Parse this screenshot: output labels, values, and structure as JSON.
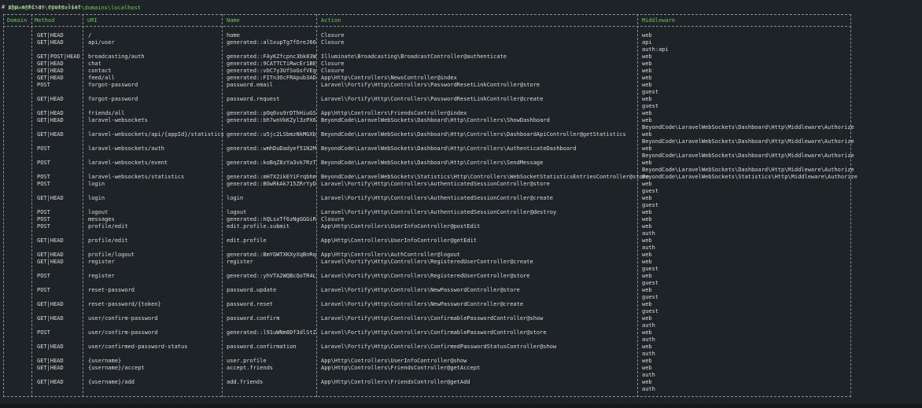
{
  "terminal": {
    "prompt": "Админ@PC d:\\OpenServer\\domains\\localhost",
    "command": "# php artisan route:list"
  },
  "columns": [
    "Domain",
    "Method",
    "URI",
    "Name",
    "Action",
    "Middleware"
  ],
  "lines": {
    "method": [
      "GET|HEAD",
      "GET|HEAD",
      "",
      "GET|POST|HEAD",
      "GET|HEAD",
      "GET|HEAD",
      "GET|HEAD",
      "POST",
      "",
      "GET|HEAD",
      "",
      "GET|HEAD",
      "GET|HEAD",
      "",
      "GET|HEAD",
      "",
      "POST",
      "",
      "POST",
      "",
      "POST",
      "POST",
      "",
      "GET|HEAD",
      "",
      "POST",
      "POST",
      "POST",
      "",
      "GET|HEAD",
      "",
      "GET|HEAD",
      "GET|HEAD",
      "",
      "POST",
      "",
      "POST",
      "",
      "GET|HEAD",
      "",
      "GET|HEAD",
      "",
      "POST",
      "",
      "GET|HEAD",
      "",
      "GET|HEAD",
      "GET|HEAD",
      "",
      "GET|HEAD",
      ""
    ],
    "uri": [
      "/",
      "api/user",
      "",
      "broadcasting/auth",
      "chat",
      "contact",
      "feed/all",
      "forgot-password",
      "",
      "forgot-password",
      "",
      "friends/all",
      "laravel-websockets",
      "",
      "laravel-websockets/api/{appId}/statistics",
      "",
      "laravel-websockets/auth",
      "",
      "laravel-websockets/event",
      "",
      "laravel-websockets/statistics",
      "login",
      "",
      "login",
      "",
      "logout",
      "messages",
      "profile/edit",
      "",
      "profile/edit",
      "",
      "profile/logout",
      "register",
      "",
      "register",
      "",
      "reset-password",
      "",
      "reset-password/{token}",
      "",
      "user/confirm-password",
      "",
      "user/confirm-password",
      "",
      "user/confirmed-password-status",
      "",
      "{username}",
      "{username}/accept",
      "",
      "{username}/add",
      ""
    ],
    "name": [
      "home",
      "generated::alSxupTg7fOreJ66",
      "",
      "generated::FAyKZfcpnc3bk83W",
      "generated::9CATTCTiRwcEr1BE",
      "generated::vbC7y3UfSoGsfVEg",
      "generated::FITn3OcFRApub3AD",
      "password.email",
      "",
      "password.request",
      "",
      "generated::pOq6vu9rDThHiuGS",
      "generated::bh7wnVkKZyl3zPX6",
      "",
      "generated::u5jc2LSbmzNkMGXb",
      "",
      "generated::wmhDuDadyef51N2M",
      "",
      "generated::koBqZ8zYa3vk7RzT",
      "",
      "generated::mH7X2ikEYiFrqbhm",
      "generated::BOwRkAk715ZRrYyD",
      "",
      "login",
      "",
      "logout",
      "generated::hQLsxTf6zNgGGGiR",
      "edit.profile.submit",
      "",
      "edit.profile",
      "",
      "generated::BmYGWTXKXyXqBnRq",
      "register",
      "",
      "generated::yhVTA2WQBcQoTR4L",
      "",
      "password.update",
      "",
      "password.reset",
      "",
      "password.confirm",
      "",
      "generated::l91uWNm8Df3dlStZ",
      "",
      "password.confirmation",
      "",
      "user.profile",
      "accept.friends",
      "",
      "add.friends",
      ""
    ],
    "action": [
      "Closure",
      "Closure",
      "",
      "Illuminate\\Broadcasting\\BroadcastController@authenticate",
      "Closure",
      "Closure",
      "App\\Http\\Controllers\\NewsController@index",
      "Laravel\\Fortify\\Http\\Controllers\\PasswordResetLinkController@store",
      "",
      "Laravel\\Fortify\\Http\\Controllers\\PasswordResetLinkController@create",
      "",
      "App\\Http\\Controllers\\FriendsController@index",
      "BeyondCode\\LaravelWebSockets\\Dashboard\\Http\\Controllers\\ShowDashboard",
      "",
      "BeyondCode\\LaravelWebSockets\\Dashboard\\Http\\Controllers\\DashboardApiController@getStatistics",
      "",
      "BeyondCode\\LaravelWebSockets\\Dashboard\\Http\\Controllers\\AuthenticateDashboard",
      "",
      "BeyondCode\\LaravelWebSockets\\Dashboard\\Http\\Controllers\\SendMessage",
      "",
      "BeyondCode\\LaravelWebSockets\\Statistics\\Http\\Controllers\\WebSocketStatisticsEntriesController@store",
      "Laravel\\Fortify\\Http\\Controllers\\AuthenticatedSessionController@store",
      "",
      "Laravel\\Fortify\\Http\\Controllers\\AuthenticatedSessionController@create",
      "",
      "Laravel\\Fortify\\Http\\Controllers\\AuthenticatedSessionController@destroy",
      "Closure",
      "App\\Http\\Controllers\\UserInfoController@postEdit",
      "",
      "App\\Http\\Controllers\\UserInfoController@getEdit",
      "",
      "App\\Http\\Controllers\\AuthController@logout",
      "Laravel\\Fortify\\Http\\Controllers\\RegisteredUserController@create",
      "",
      "Laravel\\Fortify\\Http\\Controllers\\RegisteredUserController@store",
      "",
      "Laravel\\Fortify\\Http\\Controllers\\NewPasswordController@store",
      "",
      "Laravel\\Fortify\\Http\\Controllers\\NewPasswordController@create",
      "",
      "Laravel\\Fortify\\Http\\Controllers\\ConfirmablePasswordController@show",
      "",
      "Laravel\\Fortify\\Http\\Controllers\\ConfirmablePasswordController@store",
      "",
      "Laravel\\Fortify\\Http\\Controllers\\ConfirmedPasswordStatusController@show",
      "",
      "App\\Http\\Controllers\\UserInfoController@show",
      "App\\Http\\Controllers\\FriendsController@getAccept",
      "",
      "App\\Http\\Controllers\\FriendsController@getAdd",
      ""
    ],
    "middleware": [
      "web",
      "api",
      "auth:api",
      "web",
      "web",
      "web",
      "web",
      "web",
      "guest",
      "web",
      "guest",
      "web",
      "web",
      "BeyondCode\\LaravelWebSockets\\Dashboard\\Http\\Middleware\\Authorize",
      "web",
      "BeyondCode\\LaravelWebSockets\\Dashboard\\Http\\Middleware\\Authorize",
      "web",
      "BeyondCode\\LaravelWebSockets\\Dashboard\\Http\\Middleware\\Authorize",
      "web",
      "BeyondCode\\LaravelWebSockets\\Dashboard\\Http\\Middleware\\Authorize",
      "BeyondCode\\LaravelWebSockets\\Statistics\\Http\\Middleware\\Authorize",
      "web",
      "guest",
      "web",
      "guest",
      "web",
      "web",
      "web",
      "auth",
      "web",
      "auth",
      "web",
      "web",
      "guest",
      "web",
      "guest",
      "web",
      "guest",
      "web",
      "guest",
      "web",
      "auth",
      "web",
      "auth",
      "web",
      "auth",
      "web",
      "web",
      "auth",
      "web",
      "auth"
    ]
  }
}
